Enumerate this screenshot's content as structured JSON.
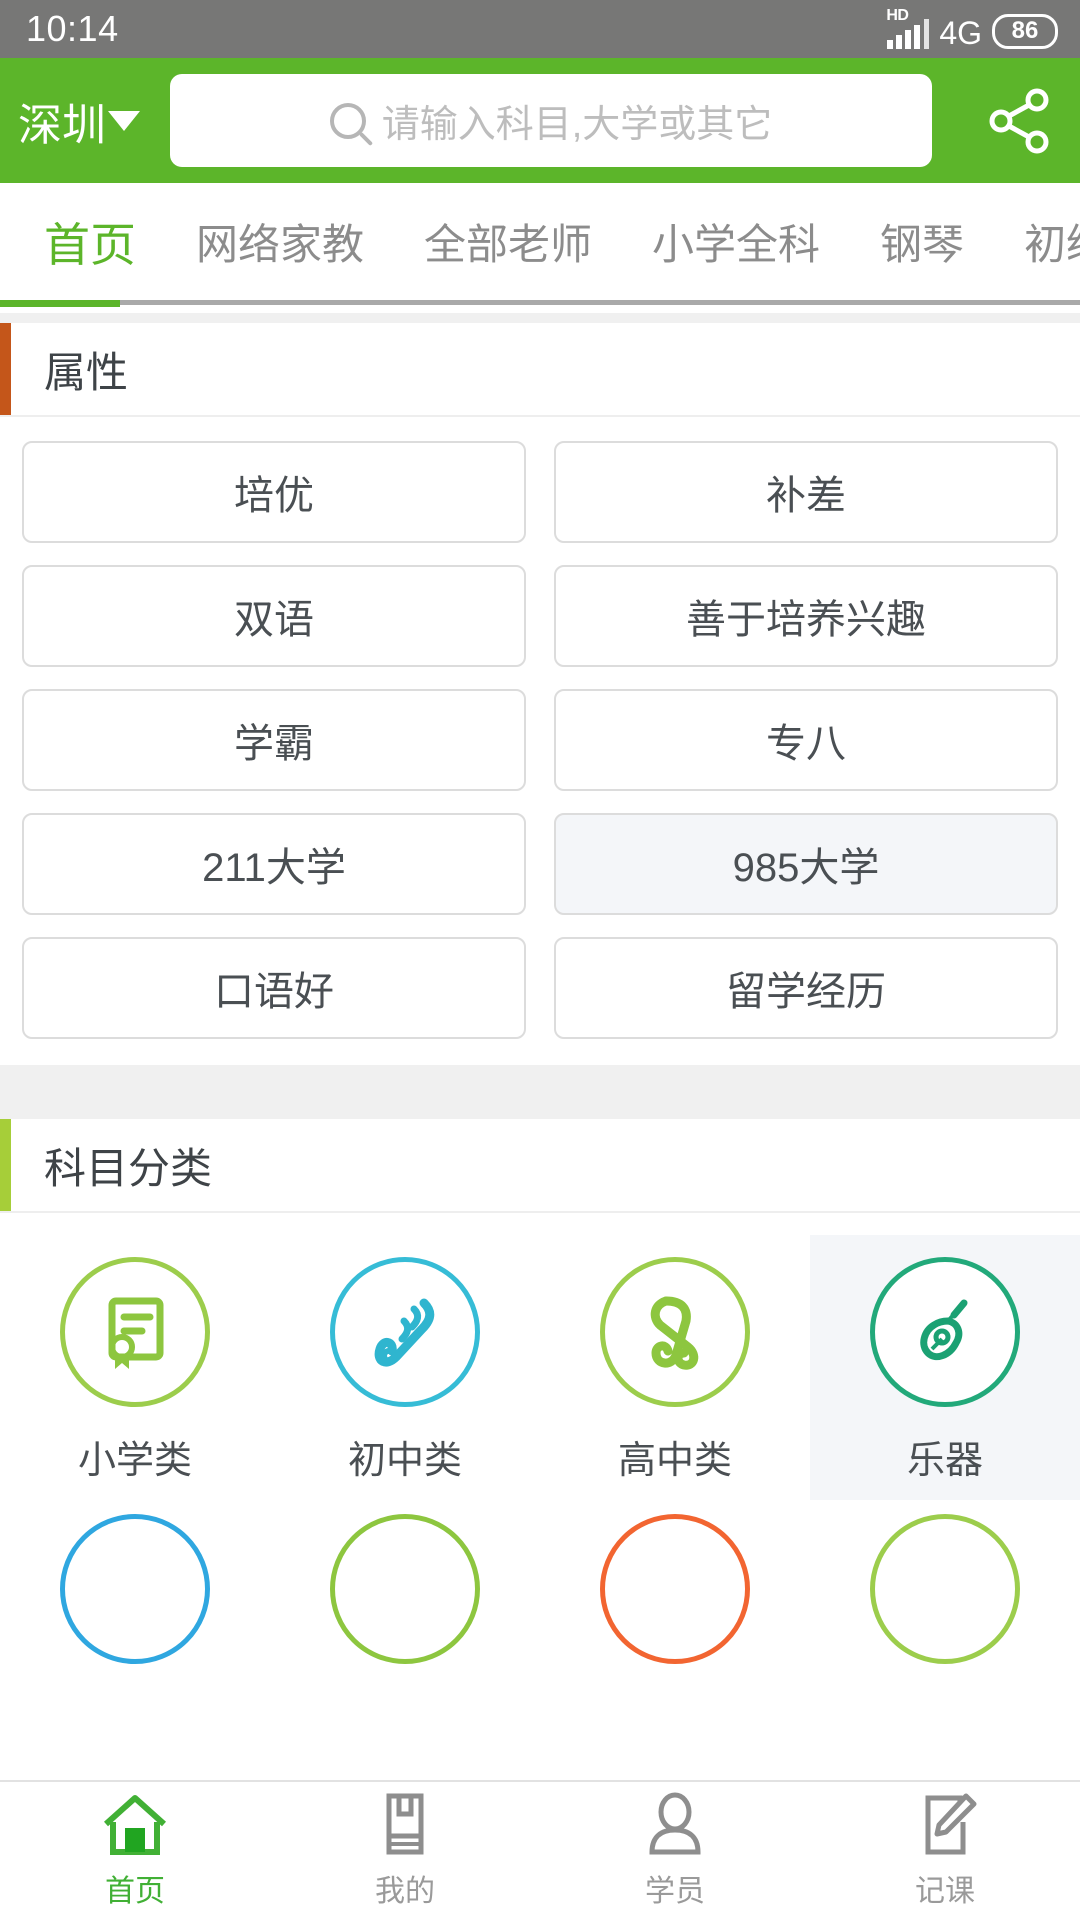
{
  "status_bar": {
    "time": "10:14",
    "hd_label": "HD",
    "network": "4G",
    "battery": "86"
  },
  "header": {
    "city": "深圳",
    "city_chevron_icon": "chevron-down-icon",
    "search_placeholder": "请输入科目,大学或其它",
    "search_value": "",
    "search_icon": "search-icon",
    "share_icon": "share-icon",
    "background_color": "#5cb52a"
  },
  "tabs": {
    "items": [
      {
        "label": "首页",
        "active": true
      },
      {
        "label": "网络家教",
        "active": false
      },
      {
        "label": "全部老师",
        "active": false
      },
      {
        "label": "小学全科",
        "active": false
      },
      {
        "label": "钢琴",
        "active": false
      },
      {
        "label": "初级英",
        "active": false
      }
    ],
    "active_color": "#5cb52a"
  },
  "attributes_section": {
    "title": "属性",
    "accent_color": "#c4561a",
    "items": [
      {
        "label": "培优",
        "selected": false
      },
      {
        "label": "补差",
        "selected": false
      },
      {
        "label": "双语",
        "selected": false
      },
      {
        "label": "善于培养兴趣",
        "selected": false
      },
      {
        "label": "学霸",
        "selected": false
      },
      {
        "label": "专八",
        "selected": false
      },
      {
        "label": "211大学",
        "selected": false
      },
      {
        "label": "985大学",
        "selected": true
      },
      {
        "label": "口语好",
        "selected": false
      },
      {
        "label": "留学经历",
        "selected": false
      }
    ]
  },
  "subjects_section": {
    "title": "科目分类",
    "accent_color": "#a6ce39",
    "items": [
      {
        "label": "小学类",
        "icon": "certificate-icon",
        "color": "#9ccd4c",
        "selected": false
      },
      {
        "label": "初中类",
        "icon": "scroll-icon",
        "color": "#36bcd6",
        "selected": false
      },
      {
        "label": "高中类",
        "icon": "diploma-icon",
        "color": "#8dc63f",
        "selected": false
      },
      {
        "label": "乐器",
        "icon": "guitar-icon",
        "color": "#22a97a",
        "selected": true
      }
    ],
    "second_row_colors": [
      "#2fa7e0",
      "#8dc63f",
      "#f26531",
      "#9ccd4c"
    ]
  },
  "bottom_nav": {
    "items": [
      {
        "label": "首页",
        "icon": "home-icon",
        "active": true
      },
      {
        "label": "我的",
        "icon": "wallet-icon",
        "active": false
      },
      {
        "label": "学员",
        "icon": "person-icon",
        "active": false
      },
      {
        "label": "记课",
        "icon": "note-pencil-icon",
        "active": false
      }
    ],
    "active_color": "#41b035",
    "inactive_color": "#9a9a9a"
  }
}
